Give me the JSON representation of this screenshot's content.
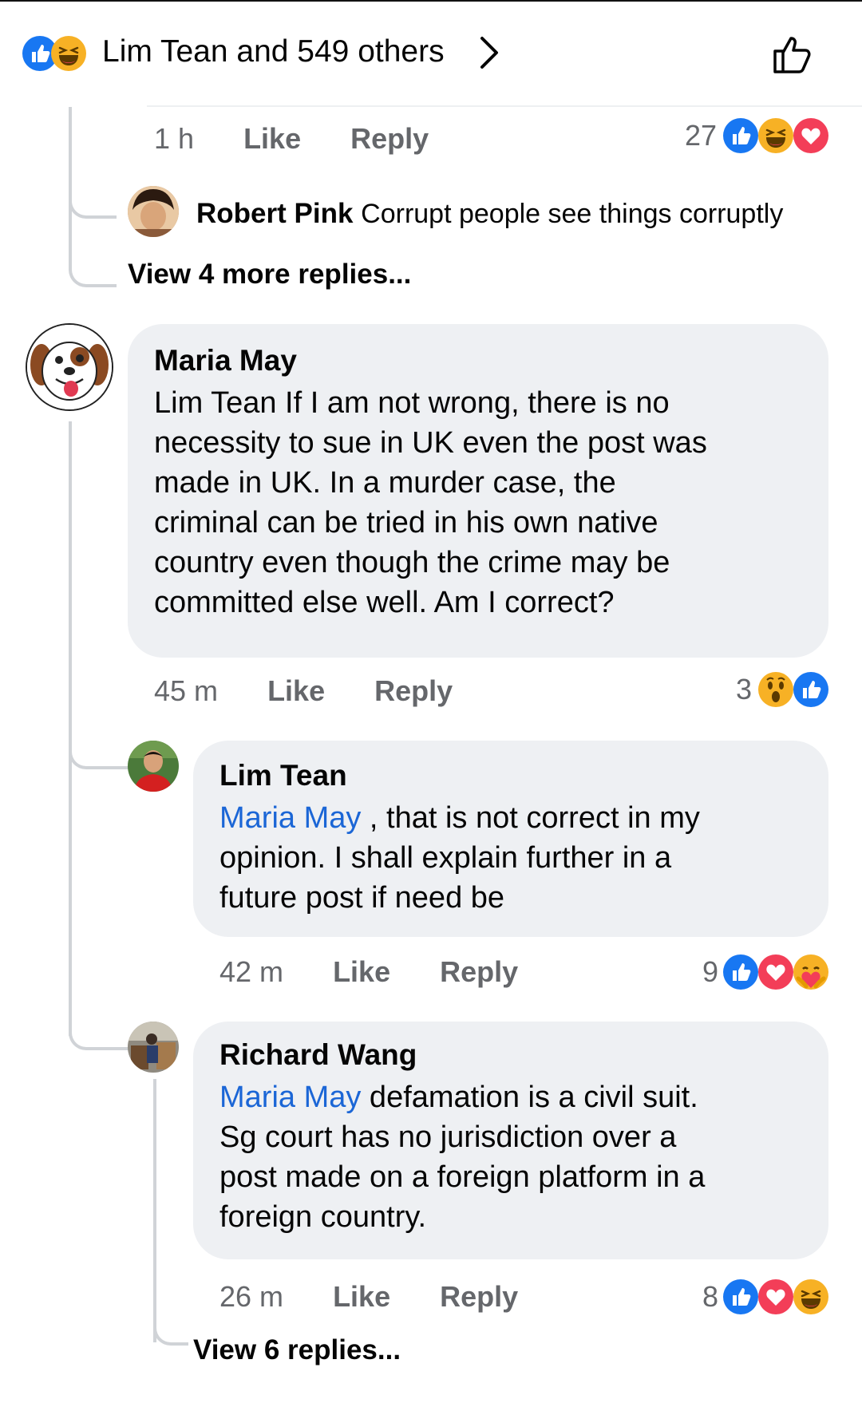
{
  "header": {
    "reactors_text": "Lim Tean and 549 others",
    "icons": [
      "like-icon",
      "haha-icon"
    ]
  },
  "colors": {
    "like_blue": "#1877f2",
    "love_red": "#f33e58",
    "haha_yellow": "#f7b125",
    "mention_blue": "#1b66d6",
    "meta_gray": "#65676b",
    "bubble_bg": "#eef0f3"
  },
  "comments": [
    {
      "time": "1 h",
      "like_label": "Like",
      "reply_label": "Reply",
      "reaction_count": "27",
      "reaction_icons": [
        "like-icon",
        "haha-icon",
        "love-icon"
      ]
    },
    {
      "author": "Robert Pink",
      "text": "Corrupt people see things corruptly"
    },
    {
      "view_more": "View 4 more replies..."
    },
    {
      "author": "Maria May",
      "text_lines": [
        "Lim Tean If I am not wrong, there is no",
        "necessity to sue in UK even the post was",
        "made in UK. In a murder case, the",
        "criminal can be tried in his own native",
        "country even though the crime may be",
        "committed else well. Am I correct?"
      ],
      "time": "45 m",
      "like_label": "Like",
      "reply_label": "Reply",
      "reaction_count": "3",
      "reaction_icons": [
        "wow-icon",
        "like-icon"
      ]
    },
    {
      "author": "Lim Tean",
      "mention": "Maria May",
      "text_first": " , that is not correct in my",
      "text_lines": [
        "opinion. I shall explain further in a",
        "future post if need be"
      ],
      "time": "42 m",
      "like_label": "Like",
      "reply_label": "Reply",
      "reaction_count": "9",
      "reaction_icons": [
        "like-icon",
        "love-icon",
        "care-icon"
      ]
    },
    {
      "author": "Richard Wang",
      "mention": "Maria May",
      "text_first": " defamation is a civil suit.",
      "text_lines": [
        "Sg court has no jurisdiction over a",
        "post made on a foreign platform in a",
        "foreign country."
      ],
      "time": "26 m",
      "like_label": "Like",
      "reply_label": "Reply",
      "reaction_count": "8",
      "reaction_icons": [
        "like-icon",
        "love-icon",
        "haha-icon"
      ]
    },
    {
      "view_more": "View 6 replies..."
    }
  ]
}
